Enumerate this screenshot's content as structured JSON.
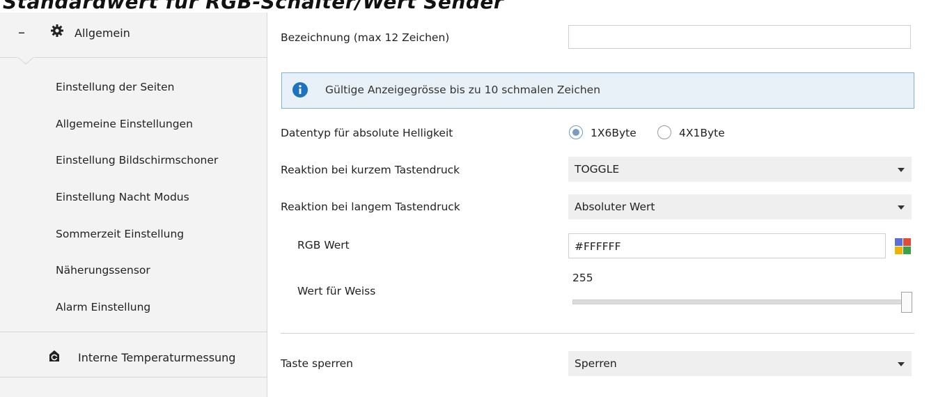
{
  "header": {
    "top_text": "Standardwert für RGB-Schalter/Wert Sender"
  },
  "sidebar": {
    "collapse_symbol": "–",
    "section_title": "Allgemein",
    "section_icon": "gear-icon",
    "items": [
      {
        "label": "Einstellung der Seiten"
      },
      {
        "label": "Allgemeine Einstellungen"
      },
      {
        "label": "Einstellung Bildschirmschoner"
      },
      {
        "label": "Einstellung Nacht Modus"
      },
      {
        "label": "Sommerzeit Einstellung"
      },
      {
        "label": "Näherungssensor"
      },
      {
        "label": "Alarm Einstellung"
      }
    ],
    "next_section": {
      "label": "Interne Temperaturmessung",
      "icon": "temperature-device-icon"
    }
  },
  "form": {
    "name_label": "Bezeichnung (max 12 Zeichen)",
    "name_value": "",
    "info_text": "Gültige Anzeigegrösse bis zu 10 schmalen Zeichen",
    "datatype_label": "Datentyp für absolute Helligkeit",
    "datatype_options": [
      {
        "label": "1X6Byte",
        "selected": true
      },
      {
        "label": "4X1Byte",
        "selected": false
      }
    ],
    "short_press_label": "Reaktion bei kurzem Tastendruck",
    "short_press_value": "TOGGLE",
    "long_press_label": "Reaktion bei langem Tastendruck",
    "long_press_value": "Absoluter Wert",
    "rgb_label": "RGB Wert",
    "rgb_value": "#FFFFFF",
    "white_label": "Wert für Weiss",
    "white_value": "255",
    "lock_label": "Taste sperren",
    "lock_value": "Sperren"
  },
  "colors": {
    "info_bg": "#e8f1f7",
    "info_border": "#7fb0d8",
    "info_icon": "#1e73be",
    "sidebar_bg": "#f3f3f3"
  }
}
